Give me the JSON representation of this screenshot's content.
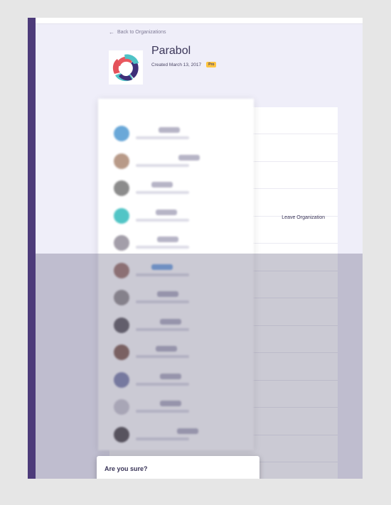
{
  "nav": {
    "back_label": "Back to Organizations"
  },
  "org": {
    "name": "Parabol",
    "created": "Created March 13, 2017",
    "tier": "Pro",
    "leave_label": "Leave Organization"
  },
  "members_popover": {
    "header": "",
    "members": [
      {
        "name": "",
        "tag_color": "#b6b4c6",
        "avatar_color": "#6aa8d8"
      },
      {
        "name": "",
        "tag_color": "#b6b4c6",
        "avatar_color": "#b89a88"
      },
      {
        "name": "",
        "tag_color": "#b6b4c6",
        "avatar_color": "#8c8c8c"
      },
      {
        "name": "",
        "tag_color": "#b6b4c6",
        "avatar_color": "#52c5c6"
      },
      {
        "name": "",
        "tag_color": "#b6b4c6",
        "avatar_color": "#a39ea9"
      },
      {
        "name": "",
        "tag_color": "#7faee6",
        "avatar_color": "#a8837a"
      },
      {
        "name": "",
        "tag_color": "#b6b4c6",
        "avatar_color": "#9f9a9a"
      },
      {
        "name": "",
        "tag_color": "#b6b4c6",
        "avatar_color": "#6e6a6f"
      },
      {
        "name": "",
        "tag_color": "#b6b4c6",
        "avatar_color": "#8f6e62"
      },
      {
        "name": "",
        "tag_color": "#b6b4c6",
        "avatar_color": "#8a8fb6"
      },
      {
        "name": "",
        "tag_color": "#b6b4c6",
        "avatar_color": "#cfcdd6"
      },
      {
        "name": "",
        "tag_color": "#b6b4c6",
        "avatar_color": "#5f5a5c"
      }
    ]
  },
  "dialog": {
    "title": "Are you sure?"
  },
  "colors": {
    "rail": "#4d3b7a",
    "page_bg": "#efeef9",
    "pro_badge": "#ffc440",
    "overlay": "rgba(68,63,100,0.28)"
  },
  "icons": {
    "back": "arrow-left-icon",
    "logo": "parabol-logo-icon"
  }
}
